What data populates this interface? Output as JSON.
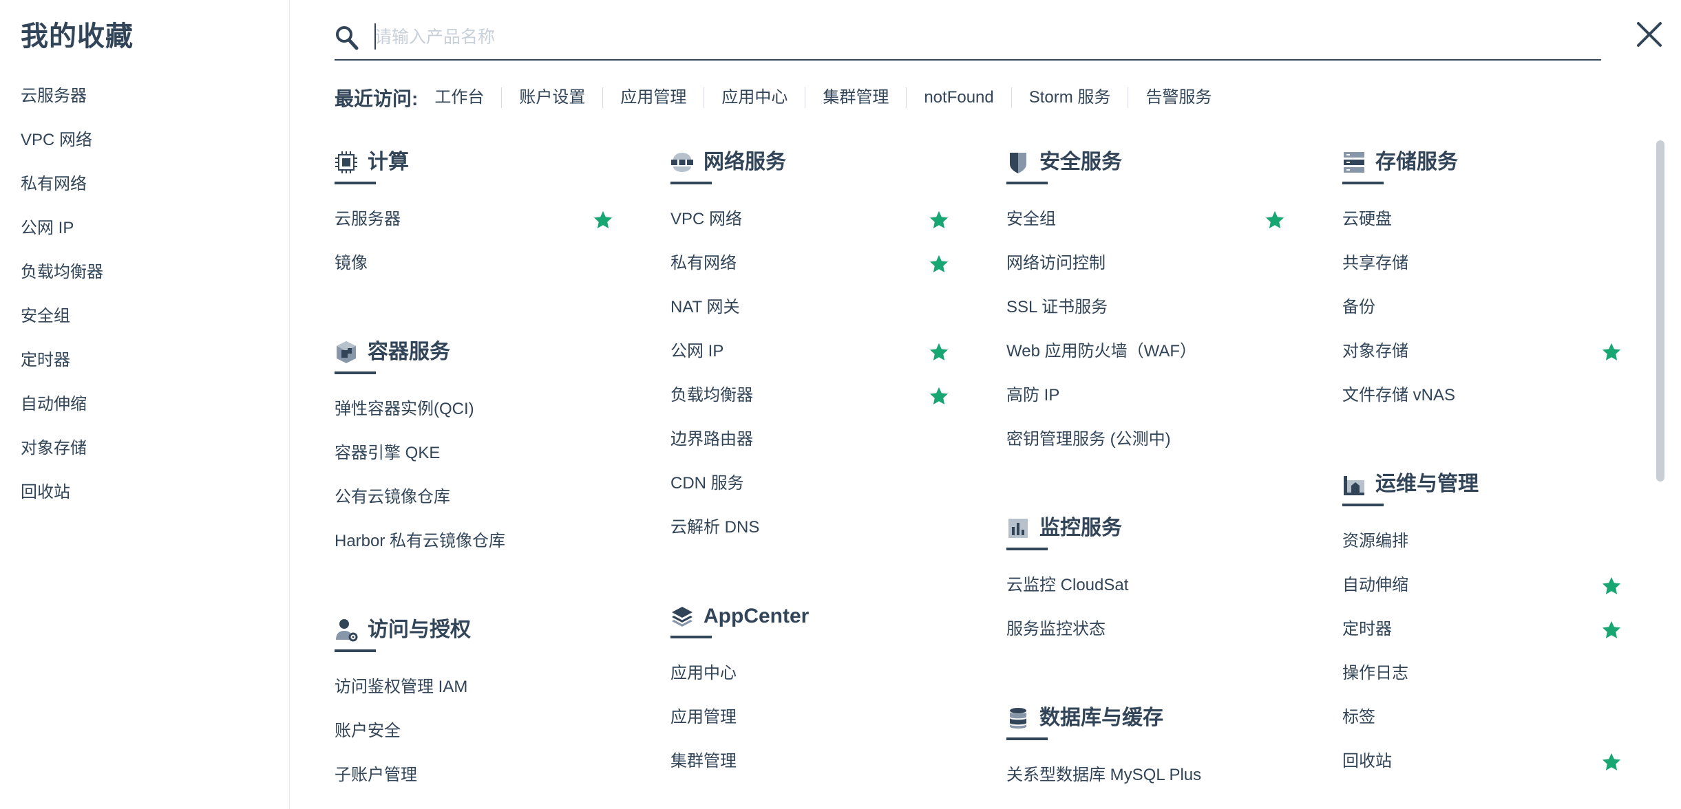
{
  "sidebar": {
    "title": "我的收藏",
    "items": [
      "云服务器",
      "VPC 网络",
      "私有网络",
      "公网 IP",
      "负载均衡器",
      "安全组",
      "定时器",
      "自动伸缩",
      "对象存储",
      "回收站"
    ]
  },
  "search": {
    "placeholder": "请输入产品名称",
    "value": ""
  },
  "recent": {
    "label": "最近访问:",
    "items": [
      "工作台",
      "账户设置",
      "应用管理",
      "应用中心",
      "集群管理",
      "notFound",
      "Storm 服务",
      "告警服务"
    ]
  },
  "colors": {
    "text": "#324558",
    "star": "#18a672",
    "placeholder": "#c8d0d9",
    "divider": "#e6ebf0"
  },
  "categories": {
    "compute": {
      "icon": "cpu-icon",
      "title": "计算",
      "items": [
        {
          "label": "云服务器",
          "starred": true
        },
        {
          "label": "镜像",
          "starred": false
        }
      ]
    },
    "container": {
      "icon": "container-icon",
      "title": "容器服务",
      "items": [
        {
          "label": "弹性容器实例(QCI)"
        },
        {
          "label": "容器引擎 QKE"
        },
        {
          "label": "公有云镜像仓库"
        },
        {
          "label": "Harbor 私有云镜像仓库"
        }
      ]
    },
    "access": {
      "icon": "user-gear-icon",
      "title": "访问与授权",
      "items": [
        {
          "label": "访问鉴权管理 IAM"
        },
        {
          "label": "账户安全"
        },
        {
          "label": "子账户管理"
        }
      ]
    },
    "network": {
      "icon": "network-icon",
      "title": "网络服务",
      "items": [
        {
          "label": "VPC 网络",
          "starred": true
        },
        {
          "label": "私有网络",
          "starred": true
        },
        {
          "label": "NAT 网关",
          "starred": false
        },
        {
          "label": "公网 IP",
          "starred": true
        },
        {
          "label": "负载均衡器",
          "starred": true
        },
        {
          "label": "边界路由器",
          "starred": false
        },
        {
          "label": "CDN 服务",
          "starred": false
        },
        {
          "label": "云解析 DNS",
          "starred": false
        }
      ]
    },
    "appcenter": {
      "icon": "layers-icon",
      "title": "AppCenter",
      "items": [
        {
          "label": "应用中心"
        },
        {
          "label": "应用管理"
        },
        {
          "label": "集群管理"
        }
      ]
    },
    "security": {
      "icon": "shield-icon",
      "title": "安全服务",
      "items": [
        {
          "label": "安全组",
          "starred": true
        },
        {
          "label": "网络访问控制"
        },
        {
          "label": "SSL 证书服务"
        },
        {
          "label": "Web 应用防火墙（WAF）"
        },
        {
          "label": "高防 IP"
        },
        {
          "label": "密钥管理服务 (公测中)"
        }
      ]
    },
    "monitor": {
      "icon": "bar-chart-icon",
      "title": "监控服务",
      "items": [
        {
          "label": "云监控 CloudSat"
        },
        {
          "label": "服务监控状态"
        }
      ]
    },
    "database": {
      "icon": "database-icon",
      "title": "数据库与缓存",
      "items": [
        {
          "label": "关系型数据库 MySQL Plus"
        }
      ]
    },
    "storage": {
      "icon": "storage-icon",
      "title": "存储服务",
      "items": [
        {
          "label": "云硬盘"
        },
        {
          "label": "共享存储"
        },
        {
          "label": "备份"
        },
        {
          "label": "对象存储",
          "starred": true
        },
        {
          "label": "文件存储 vNAS"
        }
      ]
    },
    "ops": {
      "icon": "factory-icon",
      "title": "运维与管理",
      "items": [
        {
          "label": "资源编排"
        },
        {
          "label": "自动伸缩",
          "starred": true
        },
        {
          "label": "定时器",
          "starred": true
        },
        {
          "label": "操作日志"
        },
        {
          "label": "标签"
        },
        {
          "label": "回收站",
          "starred": true
        }
      ]
    }
  }
}
